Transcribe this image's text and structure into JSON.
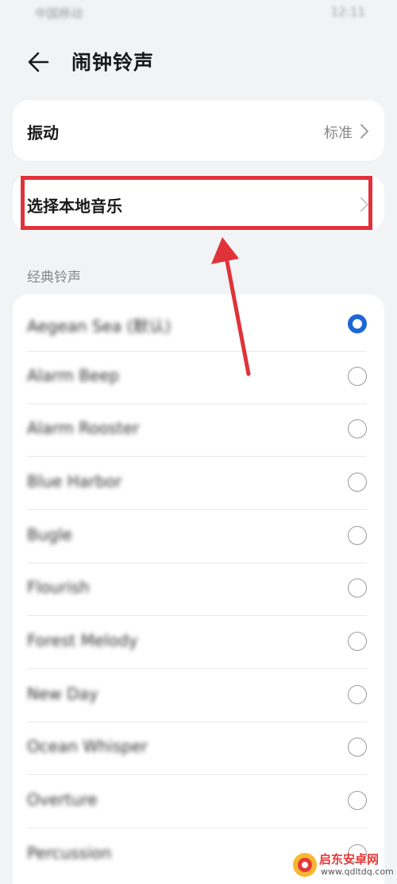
{
  "status_bar": {
    "carrier": "中国移动",
    "time": "12:11"
  },
  "header": {
    "back_icon": "back-arrow-icon",
    "title": "闹钟铃声"
  },
  "vibration": {
    "label": "振动",
    "value": "标准"
  },
  "local_music": {
    "label": "选择本地音乐"
  },
  "section": {
    "title": "经典铃声"
  },
  "ringtones": [
    {
      "name": "Aegean Sea (默认)",
      "selected": true
    },
    {
      "name": "Alarm Beep",
      "selected": false
    },
    {
      "name": "Alarm Rooster",
      "selected": false
    },
    {
      "name": "Blue Harbor",
      "selected": false
    },
    {
      "name": "Bugle",
      "selected": false
    },
    {
      "name": "Flourish",
      "selected": false
    },
    {
      "name": "Forest Melody",
      "selected": false
    },
    {
      "name": "New Day",
      "selected": false
    },
    {
      "name": "Ocean Whisper",
      "selected": false
    },
    {
      "name": "Overture",
      "selected": false
    },
    {
      "name": "Percussion",
      "selected": false
    }
  ],
  "colors": {
    "accent": "#1d66d6",
    "annotation": "#e0323a",
    "background": "#f1f3f5"
  },
  "watermark": {
    "name": "启东安卓网",
    "url": "www.qdltdq.com"
  }
}
